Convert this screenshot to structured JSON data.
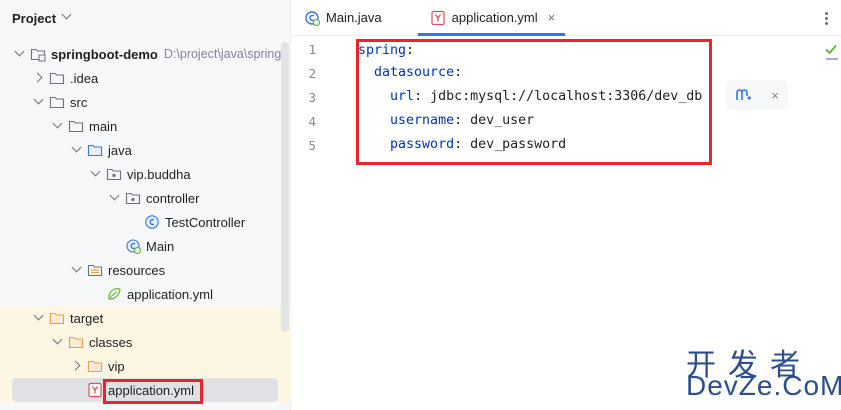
{
  "project_panel": {
    "title": "Project",
    "tree": [
      {
        "label": "springboot-demo",
        "hint": "D:\\project\\java\\spring",
        "bold": true,
        "icon": "module-folder-icon",
        "arrow": "down",
        "depth": 0
      },
      {
        "label": ".idea",
        "icon": "folder-icon",
        "arrow": "right",
        "depth": 1
      },
      {
        "label": "src",
        "icon": "folder-icon",
        "arrow": "down",
        "depth": 1
      },
      {
        "label": "main",
        "icon": "folder-icon",
        "arrow": "down",
        "depth": 2
      },
      {
        "label": "java",
        "icon": "source-folder-icon",
        "arrow": "down",
        "depth": 3
      },
      {
        "label": "vip.buddha",
        "icon": "package-icon",
        "arrow": "down",
        "depth": 4
      },
      {
        "label": "controller",
        "icon": "package-icon",
        "arrow": "down",
        "depth": 5
      },
      {
        "label": "TestController",
        "icon": "class-icon",
        "arrow": "none",
        "depth": 6
      },
      {
        "label": "Main",
        "icon": "spring-class-icon",
        "arrow": "none",
        "depth": 5
      },
      {
        "label": "resources",
        "icon": "resources-folder-icon",
        "arrow": "down",
        "depth": 3
      },
      {
        "label": "application.yml",
        "icon": "spring-yaml-icon",
        "arrow": "none",
        "depth": 4
      },
      {
        "label": "target",
        "icon": "excluded-folder-icon",
        "arrow": "down",
        "depth": 1,
        "excluded": true
      },
      {
        "label": "classes",
        "icon": "excluded-folder-icon",
        "arrow": "down",
        "depth": 2,
        "excluded": true
      },
      {
        "label": "vip",
        "icon": "excluded-folder-icon",
        "arrow": "right",
        "depth": 3,
        "excluded": true
      },
      {
        "label": "application.yml",
        "icon": "yaml-icon",
        "arrow": "none",
        "depth": 3,
        "excluded": true,
        "selected": true
      }
    ]
  },
  "editor": {
    "tabs": [
      {
        "label": "Main.java",
        "icon": "spring-class-icon",
        "active": false
      },
      {
        "label": "application.yml",
        "icon": "yaml-icon",
        "active": true,
        "close": "×"
      }
    ],
    "line_numbers": [
      "1",
      "2",
      "3",
      "4",
      "5"
    ],
    "lines": [
      {
        "indent": "",
        "key": "spring",
        "sep": ":",
        "value": ""
      },
      {
        "indent": "  ",
        "key": "datasource",
        "sep": ":",
        "value": ""
      },
      {
        "indent": "    ",
        "key": "url",
        "sep": ": ",
        "value": "jdbc:mysql://localhost:3306/dev_db"
      },
      {
        "indent": "    ",
        "key": "username",
        "sep": ": ",
        "value": "dev_user"
      },
      {
        "indent": "    ",
        "key": "password",
        "sep": ": ",
        "value": "dev_password"
      }
    ],
    "popup_close": "×"
  },
  "watermark": {
    "top": "开发者",
    "bottom": "DevZe.CoM"
  },
  "colors": {
    "highlight_box": "#e5262b",
    "key": "#0033b3",
    "accent": "#3574f0"
  }
}
